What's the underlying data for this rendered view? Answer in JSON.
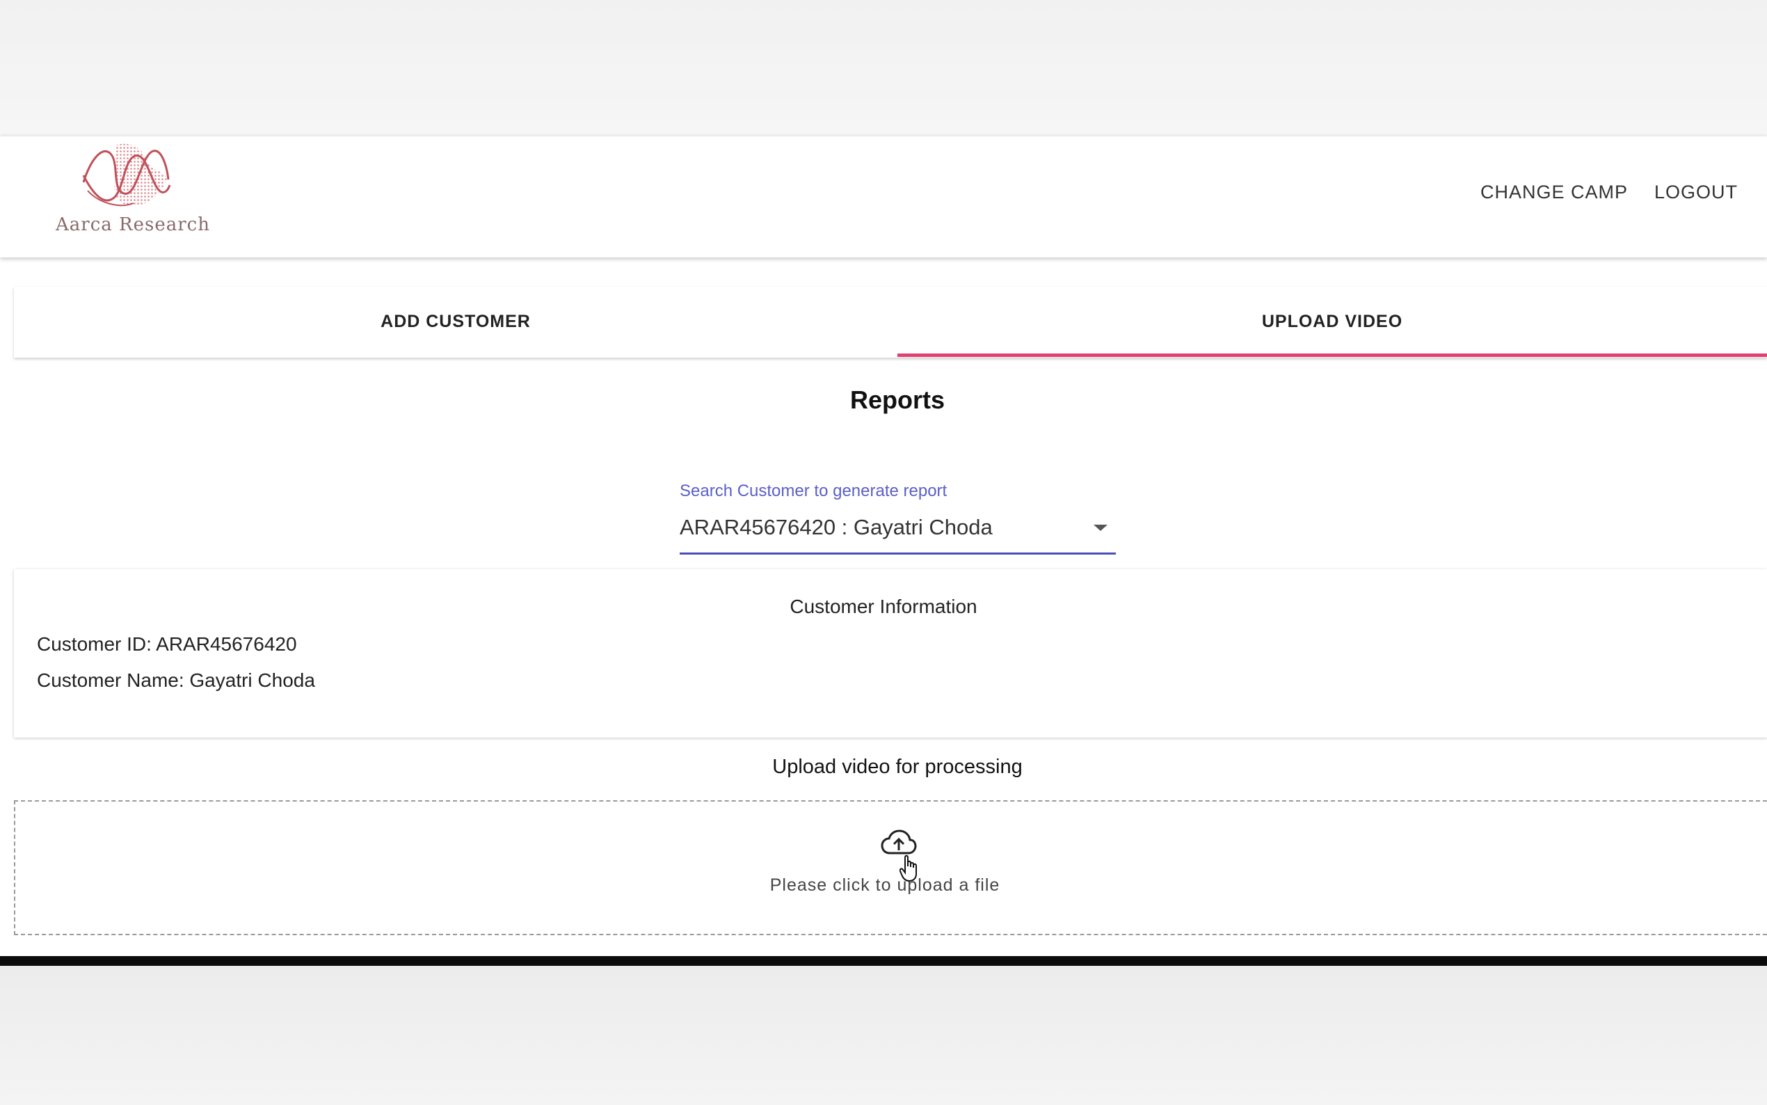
{
  "header": {
    "logo_text": "Aarca Research",
    "nav": {
      "change_camp": "CHANGE CAMP",
      "logout": "LOGOUT"
    }
  },
  "tabs": {
    "add_customer": "ADD CUSTOMER",
    "upload_video": "UPLOAD VIDEO",
    "active": "UPLOAD VIDEO"
  },
  "main": {
    "title": "Reports",
    "search": {
      "label": "Search Customer to generate report",
      "value": "ARAR45676420 : Gayatri Choda"
    },
    "customer_info": {
      "title": "Customer Information",
      "id_line": "Customer ID: ARAR45676420",
      "name_line": "Customer Name: Gayatri Choda"
    },
    "upload": {
      "heading": "Upload video for processing",
      "prompt": "Please click to upload a file",
      "icon": "cloud-upload-icon"
    }
  },
  "colors": {
    "tab_indicator": "#e2406f",
    "search_accent": "#4a4fb8",
    "logo": "#c0505a"
  }
}
